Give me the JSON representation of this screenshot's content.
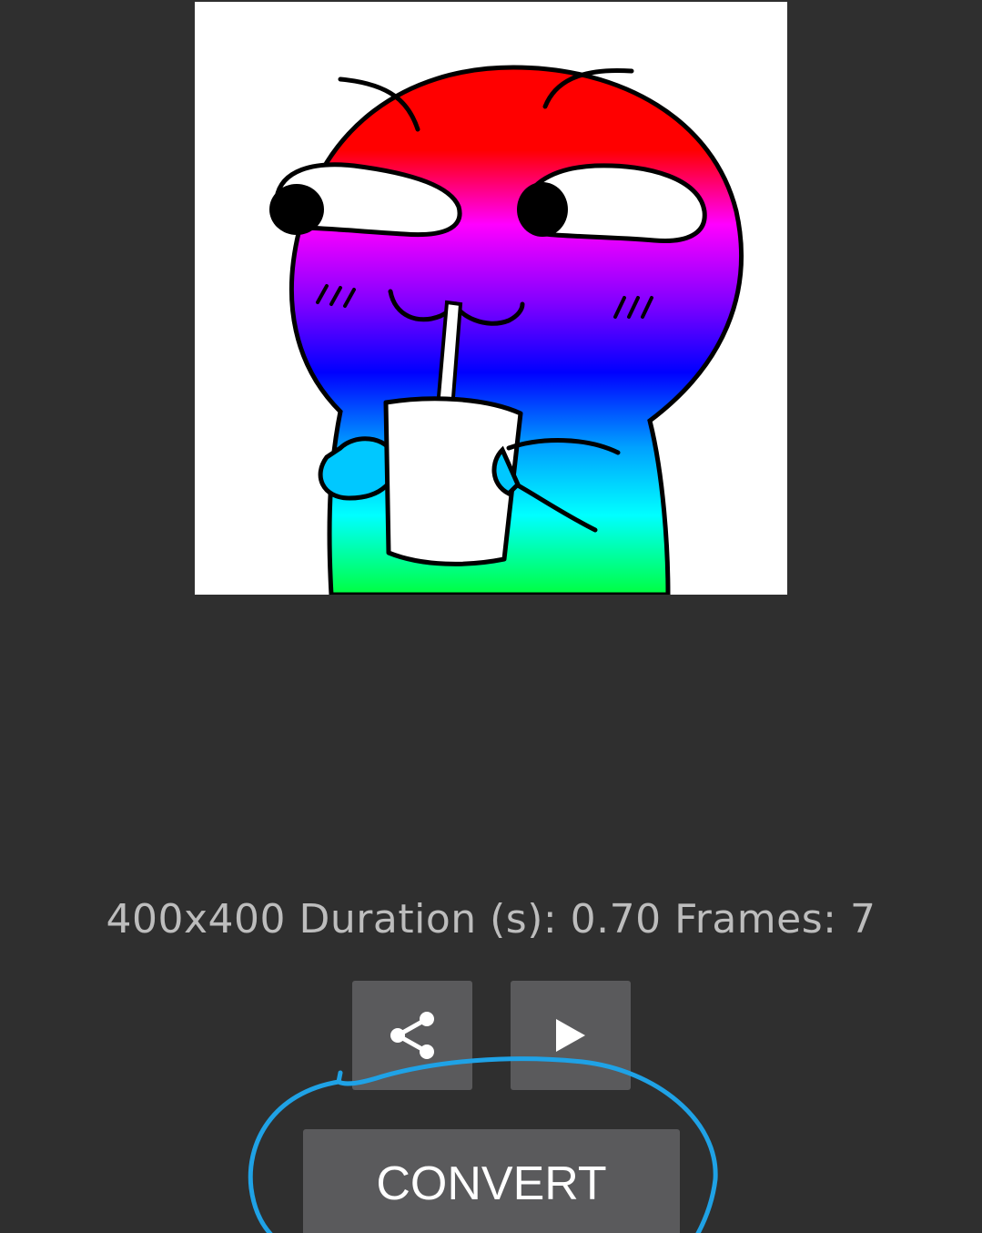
{
  "info_text": "400x400 Duration (s): 0.70 Frames: 7",
  "buttons": {
    "share_icon": "share-icon",
    "play_icon": "play-icon",
    "convert_label": "CONVERT"
  },
  "colors": {
    "background": "#2f2f2f",
    "button": "#5a5a5c",
    "info_text": "#bdbdbd",
    "annotation_stroke": "#1fa2e6"
  }
}
